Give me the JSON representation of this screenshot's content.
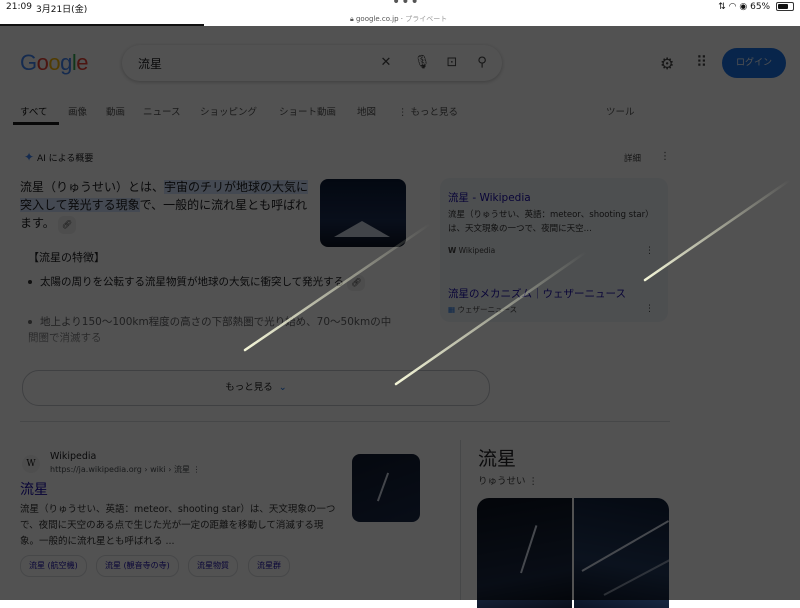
{
  "status": {
    "time": "21:09",
    "date": "3月21日(金)",
    "url": "google.co.jp",
    "private": "プライベート",
    "battery": "65%",
    "battery_level": 0.65
  },
  "search": {
    "logo": "Google",
    "query": "流星",
    "login": "ログイン"
  },
  "tabs": [
    "すべて",
    "画像",
    "動画",
    "ニュース",
    "ショッピング",
    "ショート動画",
    "地図",
    "もっと見る"
  ],
  "tools": "ツール",
  "ai": {
    "label": "AI による概要",
    "detail": "詳細",
    "intro_pre": "流星（りゅうせい）とは、",
    "intro_hl": "宇宙のチリが地球の大気に突入して発光する現象",
    "intro_post": "で、一般的に流れ星とも呼ばれます。",
    "features_title": "【流星の特徴】",
    "bullet1": "太陽の周りを公転する流星物質が地球の大気に衝突して発光する",
    "bullet2": "地上より150〜100km程度の高さの下部熱圏で光り始め、70〜50kmの中間圏で消滅する",
    "sources": [
      {
        "title": "流星 - Wikipedia",
        "snippet": "流星（りゅうせい、英語：meteor、shooting star）は、天文現象の一つで、夜間に天空...",
        "site": "Wikipedia"
      },
      {
        "title": "流星のメカニズム｜ウェザーニュース",
        "site": "ウェザーニュース"
      }
    ],
    "more": "もっと見る"
  },
  "result": {
    "site": "Wikipedia",
    "url": "https://ja.wikipedia.org › wiki › 流星",
    "title": "流星",
    "snippet": "流星（りゅうせい、英語：meteor、shooting star）は、天文現象の一つで、夜間に天空のある点で生じた光が一定の距離を移動して消滅する現象。一般的に流れ星とも呼ばれる ...",
    "chips": [
      "流星 (航空機)",
      "流星 (観音寺の寺)",
      "流星物質",
      "流星群"
    ]
  },
  "panel": {
    "title": "流星",
    "subtitle": "りゅうせい"
  },
  "colors": {
    "accent": "#1a73e8",
    "link": "#1a0dab",
    "meteor": "#f4f6d8"
  },
  "icons": [
    "clear-icon",
    "mic-icon",
    "lens-icon",
    "search-icon",
    "gear-icon",
    "apps-icon",
    "sparkle-icon",
    "wifi-icon",
    "battery-icon"
  ]
}
